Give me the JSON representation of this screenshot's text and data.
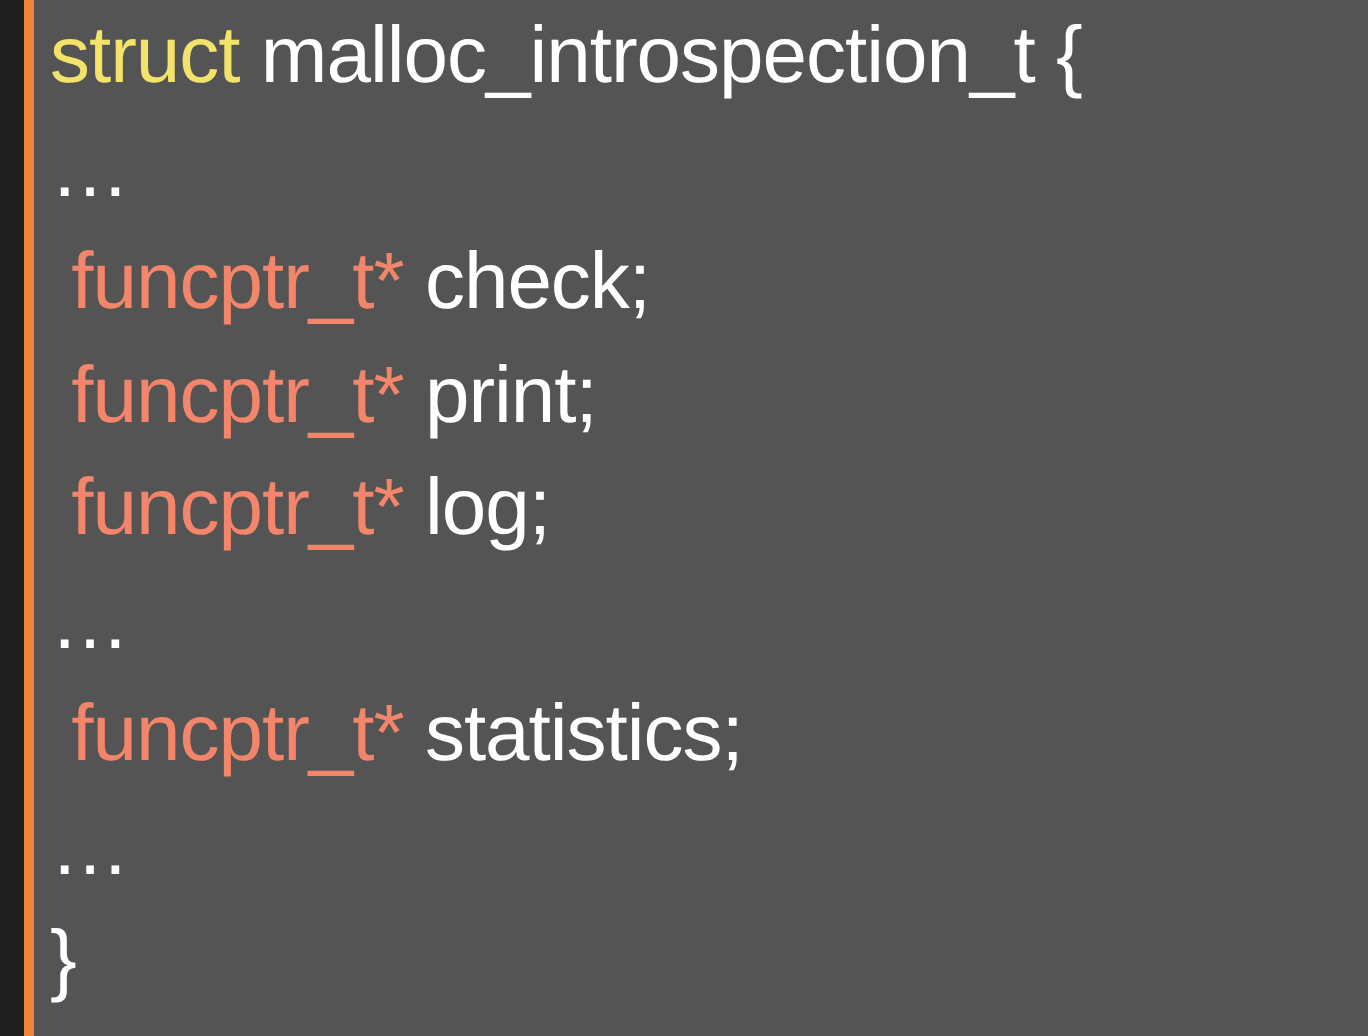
{
  "code_lines": [
    [
      {
        "kind": "keyword",
        "text": "struct"
      },
      {
        "kind": "plain",
        "text": " malloc_introspection_t {"
      }
    ],
    [
      {
        "kind": "plain",
        "text": "…"
      }
    ],
    [
      {
        "kind": "type",
        "text": " funcptr_t*"
      },
      {
        "kind": "plain",
        "text": " check;"
      }
    ],
    [
      {
        "kind": "type",
        "text": " funcptr_t*"
      },
      {
        "kind": "plain",
        "text": " print;"
      }
    ],
    [
      {
        "kind": "type",
        "text": " funcptr_t*"
      },
      {
        "kind": "plain",
        "text": " log;"
      }
    ],
    [
      {
        "kind": "plain",
        "text": "…"
      }
    ],
    [
      {
        "kind": "type",
        "text": " funcptr_t*"
      },
      {
        "kind": "plain",
        "text": " statistics;"
      }
    ],
    [
      {
        "kind": "plain",
        "text": "…"
      }
    ],
    [
      {
        "kind": "plain",
        "text": "}"
      }
    ]
  ]
}
